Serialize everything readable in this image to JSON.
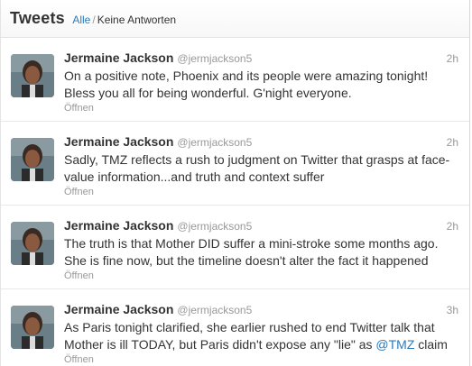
{
  "header": {
    "title": "Tweets",
    "filter_all": "Alle",
    "filter_separator": "/",
    "filter_no_replies": "Keine Antworten"
  },
  "tweets": [
    {
      "name": "Jermaine Jackson",
      "handle": "@jermjackson5",
      "time": "2h",
      "text": "On a positive note, Phoenix and its people were amazing tonight! Bless you all for being wonderful. G'night everyone.",
      "open_label": "Öffnen"
    },
    {
      "name": "Jermaine Jackson",
      "handle": "@jermjackson5",
      "time": "2h",
      "text": "Sadly, TMZ reflects a rush to judgment on Twitter that grasps at face-value information...and truth and context suffer",
      "open_label": "Öffnen"
    },
    {
      "name": "Jermaine Jackson",
      "handle": "@jermjackson5",
      "time": "2h",
      "text": "The truth is that Mother DID suffer a mini-stroke some months ago. She is fine now, but the timeline doesn't alter the fact it happened",
      "open_label": "Öffnen"
    },
    {
      "name": "Jermaine Jackson",
      "handle": "@jermjackson5",
      "time": "3h",
      "text_before": "As Paris tonight clarified, she earlier rushed to end Twitter talk that Mother is ill TODAY, but Paris didn't expose any \"lie\" as ",
      "mention": "@TMZ",
      "text_after": " claim",
      "open_label": "Öffnen"
    }
  ]
}
